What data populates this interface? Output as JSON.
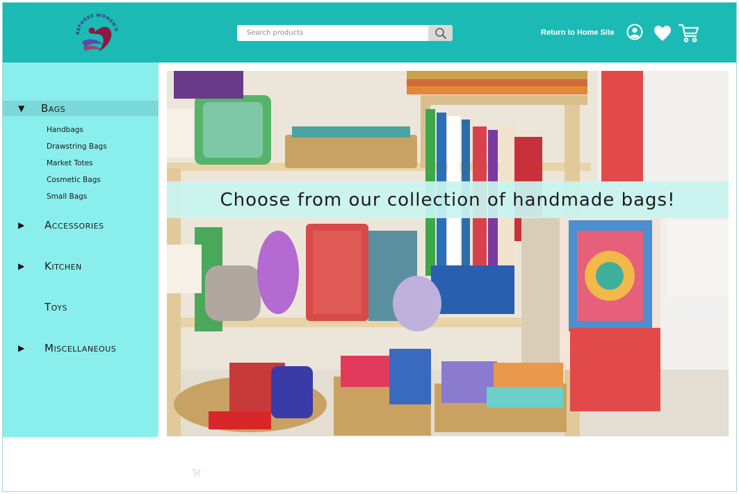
{
  "header": {
    "logo": {
      "name": "refugee-womens-center-logo",
      "text": "REFUGEE WOMEN'S CENTER"
    },
    "search": {
      "placeholder": "Search products",
      "value": ""
    },
    "return_link": "Return to Home Site",
    "icons": [
      "account-icon",
      "heart-icon",
      "cart-icon"
    ]
  },
  "sidebar": {
    "categories": [
      {
        "label": "Bags",
        "expanded": true,
        "has_arrow": true,
        "items": [
          "Handbags",
          "Drawstring Bags",
          "Market Totes",
          "Cosmetic Bags",
          "Small Bags"
        ]
      },
      {
        "label": "Accessories",
        "expanded": false,
        "has_arrow": true
      },
      {
        "label": "Kitchen",
        "expanded": false,
        "has_arrow": true
      },
      {
        "label": "Toys",
        "expanded": false,
        "has_arrow": false
      },
      {
        "label": "Miscellaneous",
        "expanded": false,
        "has_arrow": true
      }
    ]
  },
  "banner": {
    "caption": "Choose from our collection of handmade bags!"
  },
  "colors": {
    "header_bg": "#1bbab5",
    "sidebar_bg": "#8aeeec",
    "active_row": "#7ad9d8",
    "banner_caption_bg": "#c8f4f0"
  }
}
